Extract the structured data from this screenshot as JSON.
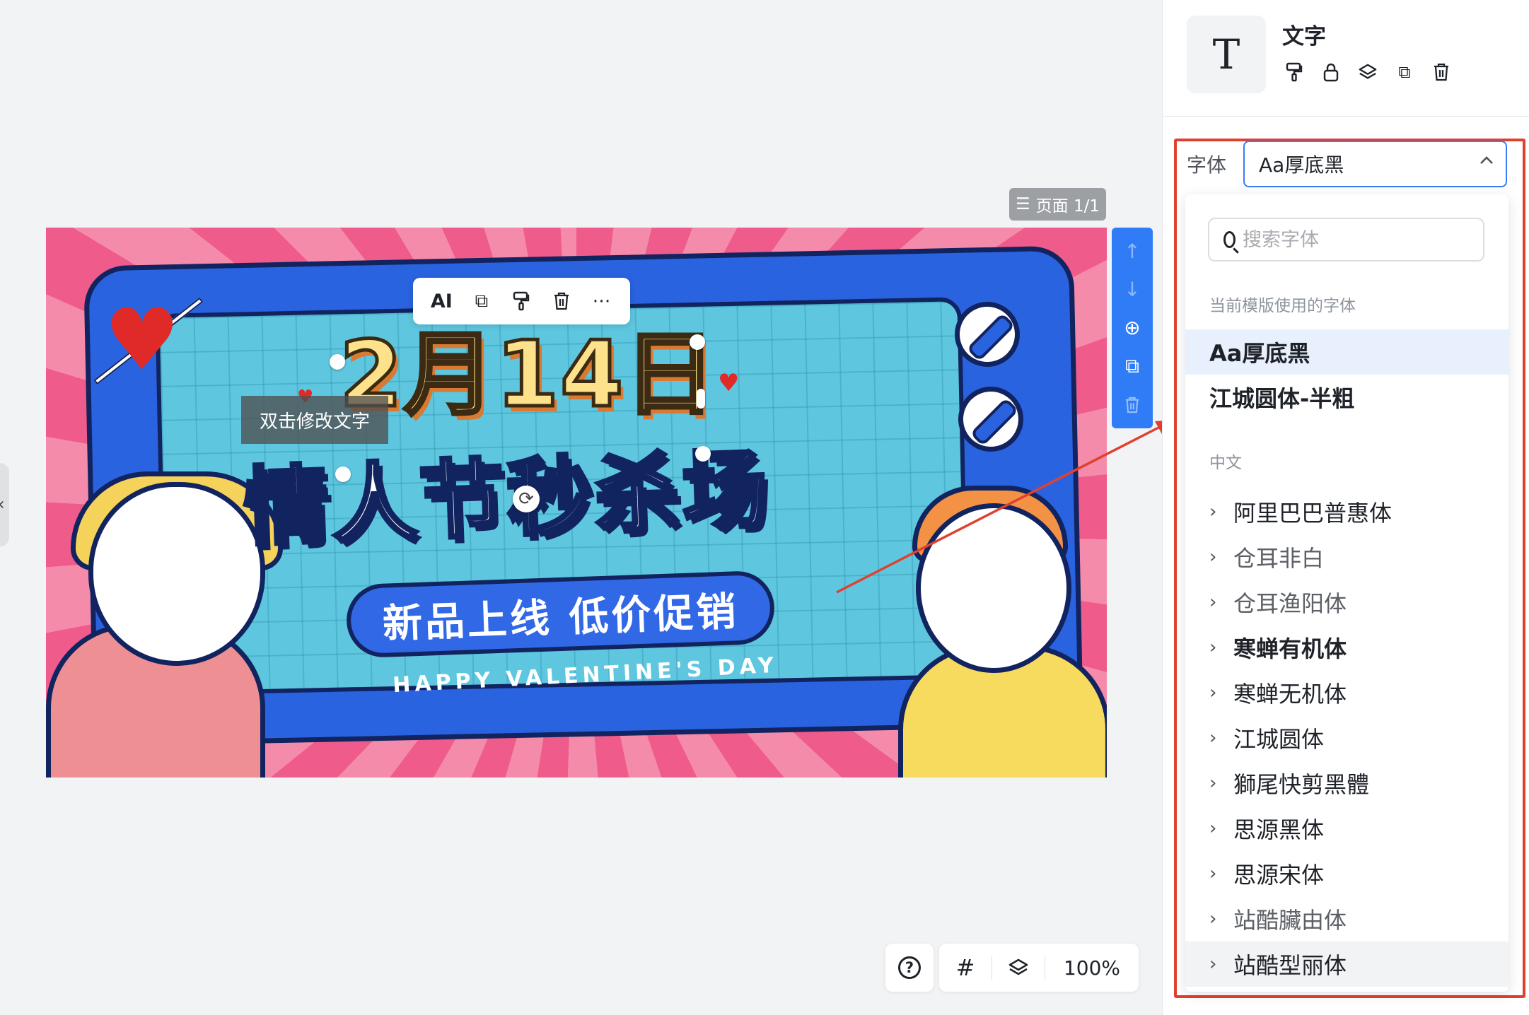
{
  "canvas": {
    "page_indicator": "页面 1/1",
    "hint_tooltip": "双击修改文字",
    "banner": {
      "date": "2月14日",
      "headline": "情人节秒杀场",
      "pill_text": "新品上线 低价促销",
      "subline": "HAPPY VALENTINE'S DAY"
    },
    "context_toolbar": {
      "ai_label": "AI",
      "items": [
        "copy-icon",
        "format-painter-icon",
        "trash-icon",
        "more-icon"
      ]
    },
    "side_strip": [
      "arrow-up-icon",
      "arrow-down-icon",
      "add-page-icon",
      "duplicate-page-icon",
      "delete-page-icon"
    ],
    "bottom_tools": {
      "help": "?",
      "zoom": "100%"
    }
  },
  "panel": {
    "element_type_icon": "T",
    "element_title": "文字",
    "element_actions": [
      "format-painter-icon",
      "lock-icon",
      "layers-icon",
      "copy-icon",
      "trash-icon"
    ],
    "font_label": "字体",
    "font_selected": "Aa厚底黑",
    "search_placeholder": "搜索字体",
    "current_section_title": "当前模版使用的字体",
    "current_fonts": [
      "Aa厚底黑",
      "江城圆体-半粗"
    ],
    "chinese_section_title": "中文",
    "chinese_fonts": [
      "阿里巴巴普惠体",
      "仓耳非白",
      "仓耳渔阳体",
      "寒蝉有机体",
      "寒蝉无机体",
      "江城圆体",
      "獅尾快剪黑體",
      "思源黑体",
      "思源宋体",
      "站酷臟由体",
      "站酷型丽体"
    ]
  },
  "colors": {
    "accent": "#3a7cf6",
    "annotation_red": "#e0412f",
    "strip_blue": "#2f7cf6"
  }
}
